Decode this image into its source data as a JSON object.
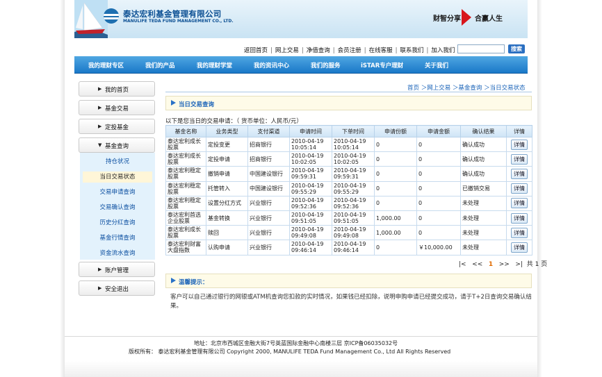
{
  "header": {
    "logo_cn": "泰达宏利基金管理有限公司",
    "logo_en": "MANULIFE TEDA FUND MANAGEMENT CO., LTD.",
    "slogan_left": "财智分享",
    "slogan_right": "合赢人生"
  },
  "toplinks": [
    "返回首页",
    "网上交易",
    "净值查询",
    "会员注册",
    "在线客服",
    "联系我们",
    "加入我们"
  ],
  "search": {
    "value": "",
    "button": "搜索"
  },
  "nav": [
    "我的理财专区",
    "我们的产品",
    "我的理财学堂",
    "我的资讯中心",
    "我们的服务",
    "iSTAR专户理财",
    "关于我们"
  ],
  "sidebar": {
    "items": [
      {
        "arrow": "▶",
        "label": "我的首页"
      },
      {
        "arrow": "▶",
        "label": "基金交易"
      },
      {
        "arrow": "▶",
        "label": "定投基金"
      },
      {
        "arrow": "▼",
        "label": "基金查询"
      },
      {
        "arrow": "▶",
        "label": "账户管理"
      },
      {
        "arrow": "▶",
        "label": "安全退出"
      }
    ],
    "sub": [
      "持仓状况",
      "当日交易状态",
      "交易申请查询",
      "交易确认查询",
      "历史分红查询",
      "基金行情查询",
      "资金流水查询"
    ]
  },
  "breadcrumb": "首页 ＞网上交易 ＞基金查询 ＞当日交易状态",
  "section_title": "当日交易查询",
  "description": "以下是您当日的交易申请：（ 货币单位：人民币/元）",
  "table": {
    "headers": [
      "基金名称",
      "业务类型",
      "支付渠道",
      "申请时间",
      "下单时间",
      "申请份额",
      "申请金额",
      "确认结果",
      "详情"
    ],
    "rows": [
      [
        "泰达宏利成长股票",
        "定投变更",
        "招商银行",
        "2010-04-19 10:05:14",
        "2010-04-19 10:05:14",
        "0",
        "0",
        "确认成功",
        "详情"
      ],
      [
        "泰达宏利成长股票",
        "定投申请",
        "招商银行",
        "2010-04-19 10:02:05",
        "2010-04-19 10:02:05",
        "0",
        "0",
        "确认成功",
        "详情"
      ],
      [
        "泰达宏利稳定股票",
        "撤销申请",
        "中国建设银行",
        "2010-04-19 09:59:31",
        "2010-04-19 09:59:31",
        "0",
        "0",
        "确认成功",
        "详情"
      ],
      [
        "泰达宏利稳定股票",
        "托管转入",
        "中国建设银行",
        "2010-04-19 09:55:29",
        "2010-04-19 09:55:29",
        "0",
        "0",
        "已撤销交易",
        "详情"
      ],
      [
        "泰达宏利稳定股票",
        "设置分红方式",
        "兴业银行",
        "2010-04-19 09:52:36",
        "2010-04-19 09:52:36",
        "0",
        "0",
        "未处理",
        "详情"
      ],
      [
        "泰达宏利首选企业股票",
        "基金转换",
        "兴业银行",
        "2010-04-19 09:51:05",
        "2010-04-19 09:51:05",
        "1,000.00",
        "0",
        "未处理",
        "详情"
      ],
      [
        "泰达宏利成长股票",
        "赎回",
        "兴业银行",
        "2010-04-19 09:49:08",
        "2010-04-19 09:49:08",
        "1,000.00",
        "0",
        "未处理",
        "详情"
      ],
      [
        "泰达宏利财富大盘指数",
        "认购申请",
        "兴业银行",
        "2010-04-19 09:46:14",
        "2010-04-19 09:46:14",
        "0",
        "￥10,000.00",
        "未处理",
        "详情"
      ]
    ]
  },
  "pager": {
    "first": "|<",
    "prev": "<<",
    "current": "1",
    "next": ">>",
    "last": ">|",
    "total": "共 1 页"
  },
  "tip": {
    "title": "温馨提示：",
    "text": "客户可以自己通过银行的网银或ATM机查询您扣款的实时情况，如果钱已经扣除，说明申购申请已经提交成功，请于T+2日查询交易确认结果。"
  },
  "footer": {
    "address": "地址：北京市西城区金融大街7号英蓝国际金融中心南楼三层 京ICP备06035032号",
    "copyright": "版权所有：  泰达宏利基金管理有限公司 Copyright 2000, MANULIFE TEDA Fund Management Co., Ltd All Rights Reserved"
  }
}
